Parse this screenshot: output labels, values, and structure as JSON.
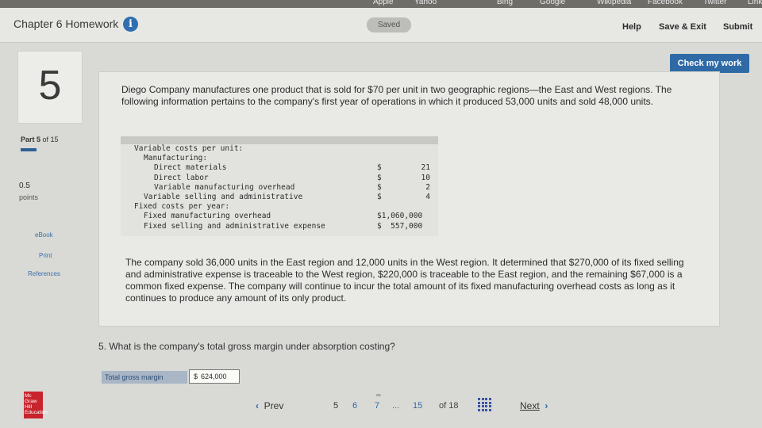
{
  "browser": {
    "bookmarks": [
      "Apple",
      "Yahoo",
      "Bing",
      "Google",
      "Wikipedia",
      "Facebook",
      "Twitter",
      "Link"
    ]
  },
  "header": {
    "title": "Chapter 6 Homework",
    "info_icon": "i",
    "saved": "Saved",
    "help": "Help",
    "save_exit": "Save & Exit",
    "submit": "Submit",
    "check_my_work": "Check my work"
  },
  "sidebar": {
    "question_number": "5",
    "part_prefix": "Part 5",
    "part_suffix": "of 15",
    "points_value": "0.5",
    "points_label": "points",
    "links": [
      "eBook",
      "Print",
      "References"
    ]
  },
  "problem": {
    "text": "Diego Company manufactures one product that is sold for $70 per unit in two geographic regions—the East and West regions. The following information pertains to the company's first year of operations in which it produced 53,000 units and sold 48,000 units.",
    "table": [
      {
        "label": "Variable costs per unit:",
        "indent": 0,
        "symbol": "",
        "amount": ""
      },
      {
        "label": "Manufacturing:",
        "indent": 1,
        "symbol": "",
        "amount": ""
      },
      {
        "label": "Direct materials",
        "indent": 2,
        "symbol": "$",
        "amount": "21"
      },
      {
        "label": "Direct labor",
        "indent": 2,
        "symbol": "$",
        "amount": "10"
      },
      {
        "label": "Variable manufacturing overhead",
        "indent": 2,
        "symbol": "$",
        "amount": "2"
      },
      {
        "label": "Variable selling and administrative",
        "indent": 1,
        "symbol": "$",
        "amount": "4"
      },
      {
        "label": "Fixed costs per year:",
        "indent": 0,
        "symbol": "",
        "amount": ""
      },
      {
        "label": "Fixed manufacturing overhead",
        "indent": 1,
        "symbol": "",
        "amount": "$1,060,000"
      },
      {
        "label": "Fixed selling and administrative expense",
        "indent": 1,
        "symbol": "",
        "amount": "$  557,000"
      }
    ],
    "paragraph2": "The company sold 36,000 units in the East region and 12,000 units in the West region. It determined that $270,000 of its fixed selling and administrative expense is traceable to the West region, $220,000 is traceable to the East region, and the remaining $67,000 is a common fixed expense. The company will continue to incur the total amount of its fixed manufacturing overhead costs as long as it continues to produce any amount of its only product."
  },
  "question": {
    "text": "5. What is the company's total gross margin under absorption costing?",
    "answer_label": "Total gross margin",
    "currency": "$",
    "answer_value": "624,000"
  },
  "footer": {
    "logo_text": "Mc Graw Hill Education",
    "prev": "Prev",
    "pages": [
      "5",
      "6",
      "7",
      "...",
      "15"
    ],
    "active_page": "5",
    "of_label": "of 18",
    "next": "Next"
  }
}
